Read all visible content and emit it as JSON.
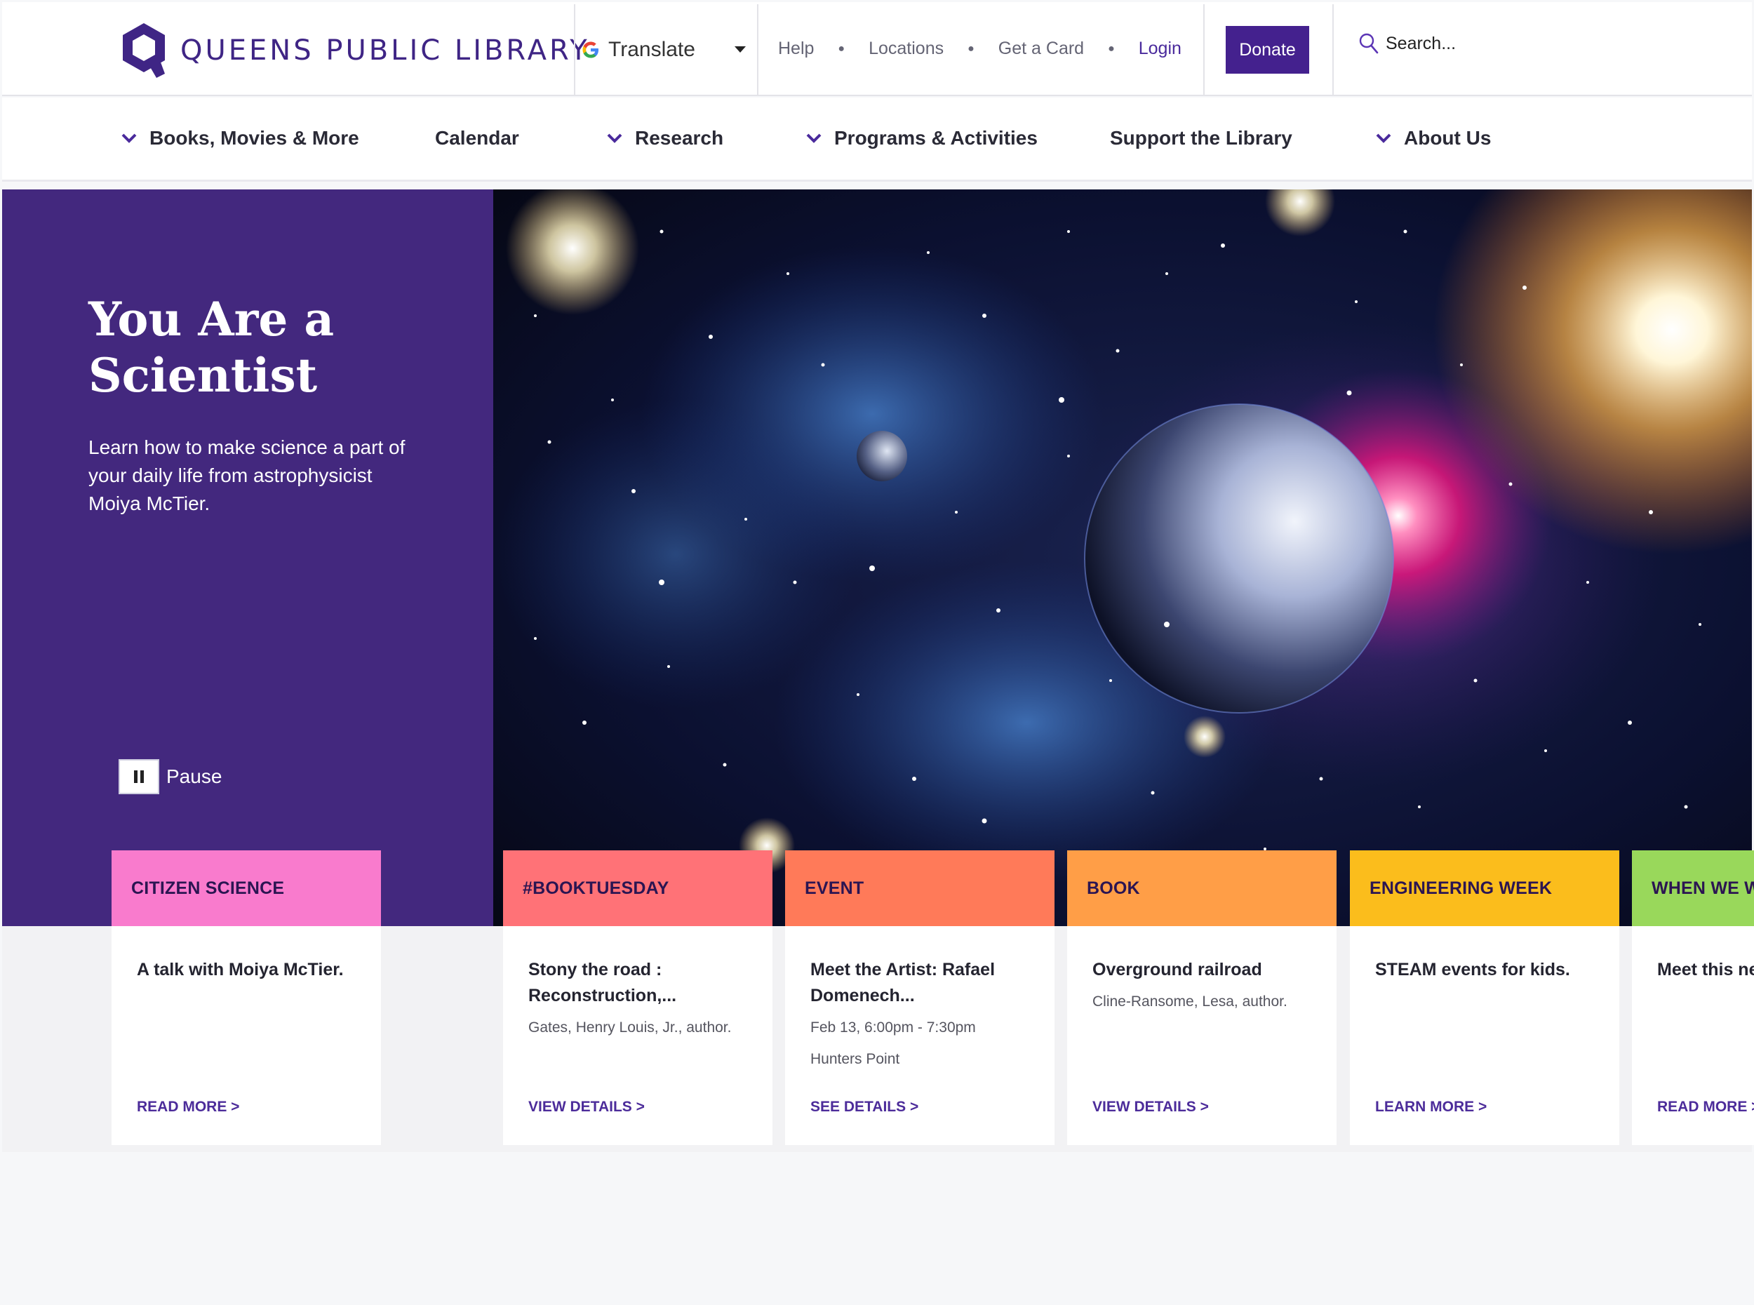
{
  "header": {
    "logo_text": "QUEENS PUBLIC LIBRARY",
    "translate_label": "Translate",
    "links": [
      "Help",
      "Locations",
      "Get a Card"
    ],
    "login_label": "Login",
    "donate_label": "Donate",
    "search_placeholder": "Search..."
  },
  "nav": {
    "items": [
      {
        "label": "Books, Movies & More"
      },
      {
        "label": "Calendar"
      },
      {
        "label": "Research"
      },
      {
        "label": "Programs & Activities"
      },
      {
        "label": "Support the Library"
      },
      {
        "label": "About Us"
      }
    ]
  },
  "hero": {
    "title": "You Are a Scientist",
    "description": "Learn how to make science a part of your daily life from astrophysicist Moiya McTier.",
    "pause_label": "Pause"
  },
  "cards": [
    {
      "tag": "CITIZEN SCIENCE",
      "title": "A talk with Moiya McTier.",
      "subtitle": "",
      "subtitle2": "",
      "link": "READ MORE >"
    },
    {
      "tag": "#BOOKTUESDAY",
      "title": "Stony the road : Reconstruction,...",
      "subtitle": "Gates, Henry Louis, Jr., author.",
      "subtitle2": "",
      "link": "VIEW DETAILS >"
    },
    {
      "tag": "EVENT",
      "title": "Meet the Artist: Rafael Domenech...",
      "subtitle": "Feb 13, 6:00pm - 7:30pm",
      "subtitle2": "Hunters Point",
      "link": "SEE DETAILS >"
    },
    {
      "tag": "BOOK",
      "title": "Overground railroad",
      "subtitle": "Cline-Ransome, Lesa, author.",
      "subtitle2": "",
      "link": "VIEW DETAILS >"
    },
    {
      "tag": "ENGINEERING WEEK",
      "title": "STEAM events for kids.",
      "subtitle": "",
      "subtitle2": "",
      "link": "LEARN MORE >"
    },
    {
      "tag": "WHEN WE W",
      "title": "Meet this ne",
      "subtitle": "",
      "subtitle2": "",
      "link": "READ MORE >"
    }
  ],
  "colors": {
    "brand_purple": "#43287e",
    "card_tags": [
      "#f97bcd",
      "#ff7277",
      "#ff7a59",
      "#ff9e47",
      "#fbbd1c",
      "#99d85b"
    ]
  },
  "icons": {
    "nav_dropdown": "chevron-down-icon",
    "search": "search-icon",
    "translate": "google-g-icon",
    "pause": "pause-icon"
  }
}
